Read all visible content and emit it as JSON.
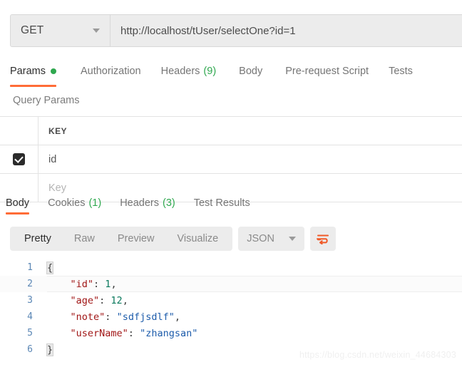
{
  "request": {
    "method": "GET",
    "url": "http://localhost/tUser/selectOne?id=1",
    "tabs": [
      {
        "label": "Params",
        "dot": true,
        "active": true
      },
      {
        "label": "Authorization",
        "active": false
      },
      {
        "label": "Headers",
        "count": "(9)",
        "active": false
      },
      {
        "label": "Body",
        "active": false
      },
      {
        "label": "Pre-request Script",
        "active": false
      },
      {
        "label": "Tests",
        "active": false
      }
    ]
  },
  "query_params": {
    "section_title": "Query Params",
    "columns": [
      "KEY"
    ],
    "rows": [
      {
        "checked": true,
        "key": "id"
      }
    ],
    "new_row_placeholder": "Key"
  },
  "response": {
    "tabs": [
      {
        "label": "Body",
        "active": true
      },
      {
        "label": "Cookies",
        "count": "(1)",
        "active": false
      },
      {
        "label": "Headers",
        "count": "(3)",
        "active": false
      },
      {
        "label": "Test Results",
        "active": false
      }
    ],
    "format_modes": [
      {
        "label": "Pretty",
        "active": true
      },
      {
        "label": "Raw",
        "active": false
      },
      {
        "label": "Preview",
        "active": false
      },
      {
        "label": "Visualize",
        "active": false
      }
    ],
    "language": "JSON",
    "wrap_icon": "word-wrap-icon",
    "body_lines": [
      {
        "n": "1",
        "tokens": [
          {
            "t": "brace",
            "v": "{"
          }
        ]
      },
      {
        "n": "2",
        "highlight": true,
        "tokens": [
          {
            "t": "plain",
            "v": "    "
          },
          {
            "t": "key",
            "v": "\"id\""
          },
          {
            "t": "punc",
            "v": ": "
          },
          {
            "t": "num",
            "v": "1"
          },
          {
            "t": "punc",
            "v": ","
          }
        ]
      },
      {
        "n": "3",
        "tokens": [
          {
            "t": "plain",
            "v": "    "
          },
          {
            "t": "key",
            "v": "\"age\""
          },
          {
            "t": "punc",
            "v": ": "
          },
          {
            "t": "num",
            "v": "12"
          },
          {
            "t": "punc",
            "v": ","
          }
        ]
      },
      {
        "n": "4",
        "tokens": [
          {
            "t": "plain",
            "v": "    "
          },
          {
            "t": "key",
            "v": "\"note\""
          },
          {
            "t": "punc",
            "v": ": "
          },
          {
            "t": "str",
            "v": "\"sdfjsdlf\""
          },
          {
            "t": "punc",
            "v": ","
          }
        ]
      },
      {
        "n": "5",
        "tokens": [
          {
            "t": "plain",
            "v": "    "
          },
          {
            "t": "key",
            "v": "\"userName\""
          },
          {
            "t": "punc",
            "v": ": "
          },
          {
            "t": "str",
            "v": "\"zhangsan\""
          }
        ]
      },
      {
        "n": "6",
        "tokens": [
          {
            "t": "brace",
            "v": "}"
          }
        ]
      }
    ]
  },
  "watermark": "https://blog.csdn.net/weixin_44684303",
  "colors": {
    "accent_orange": "#ff6c37",
    "dot_green": "#2fa84f",
    "count_green": "#2fa84f",
    "key_red": "#a11717",
    "string_blue": "#1d5cab",
    "number_green": "#0c7a5e",
    "gutter_blue": "#5b87b5"
  }
}
